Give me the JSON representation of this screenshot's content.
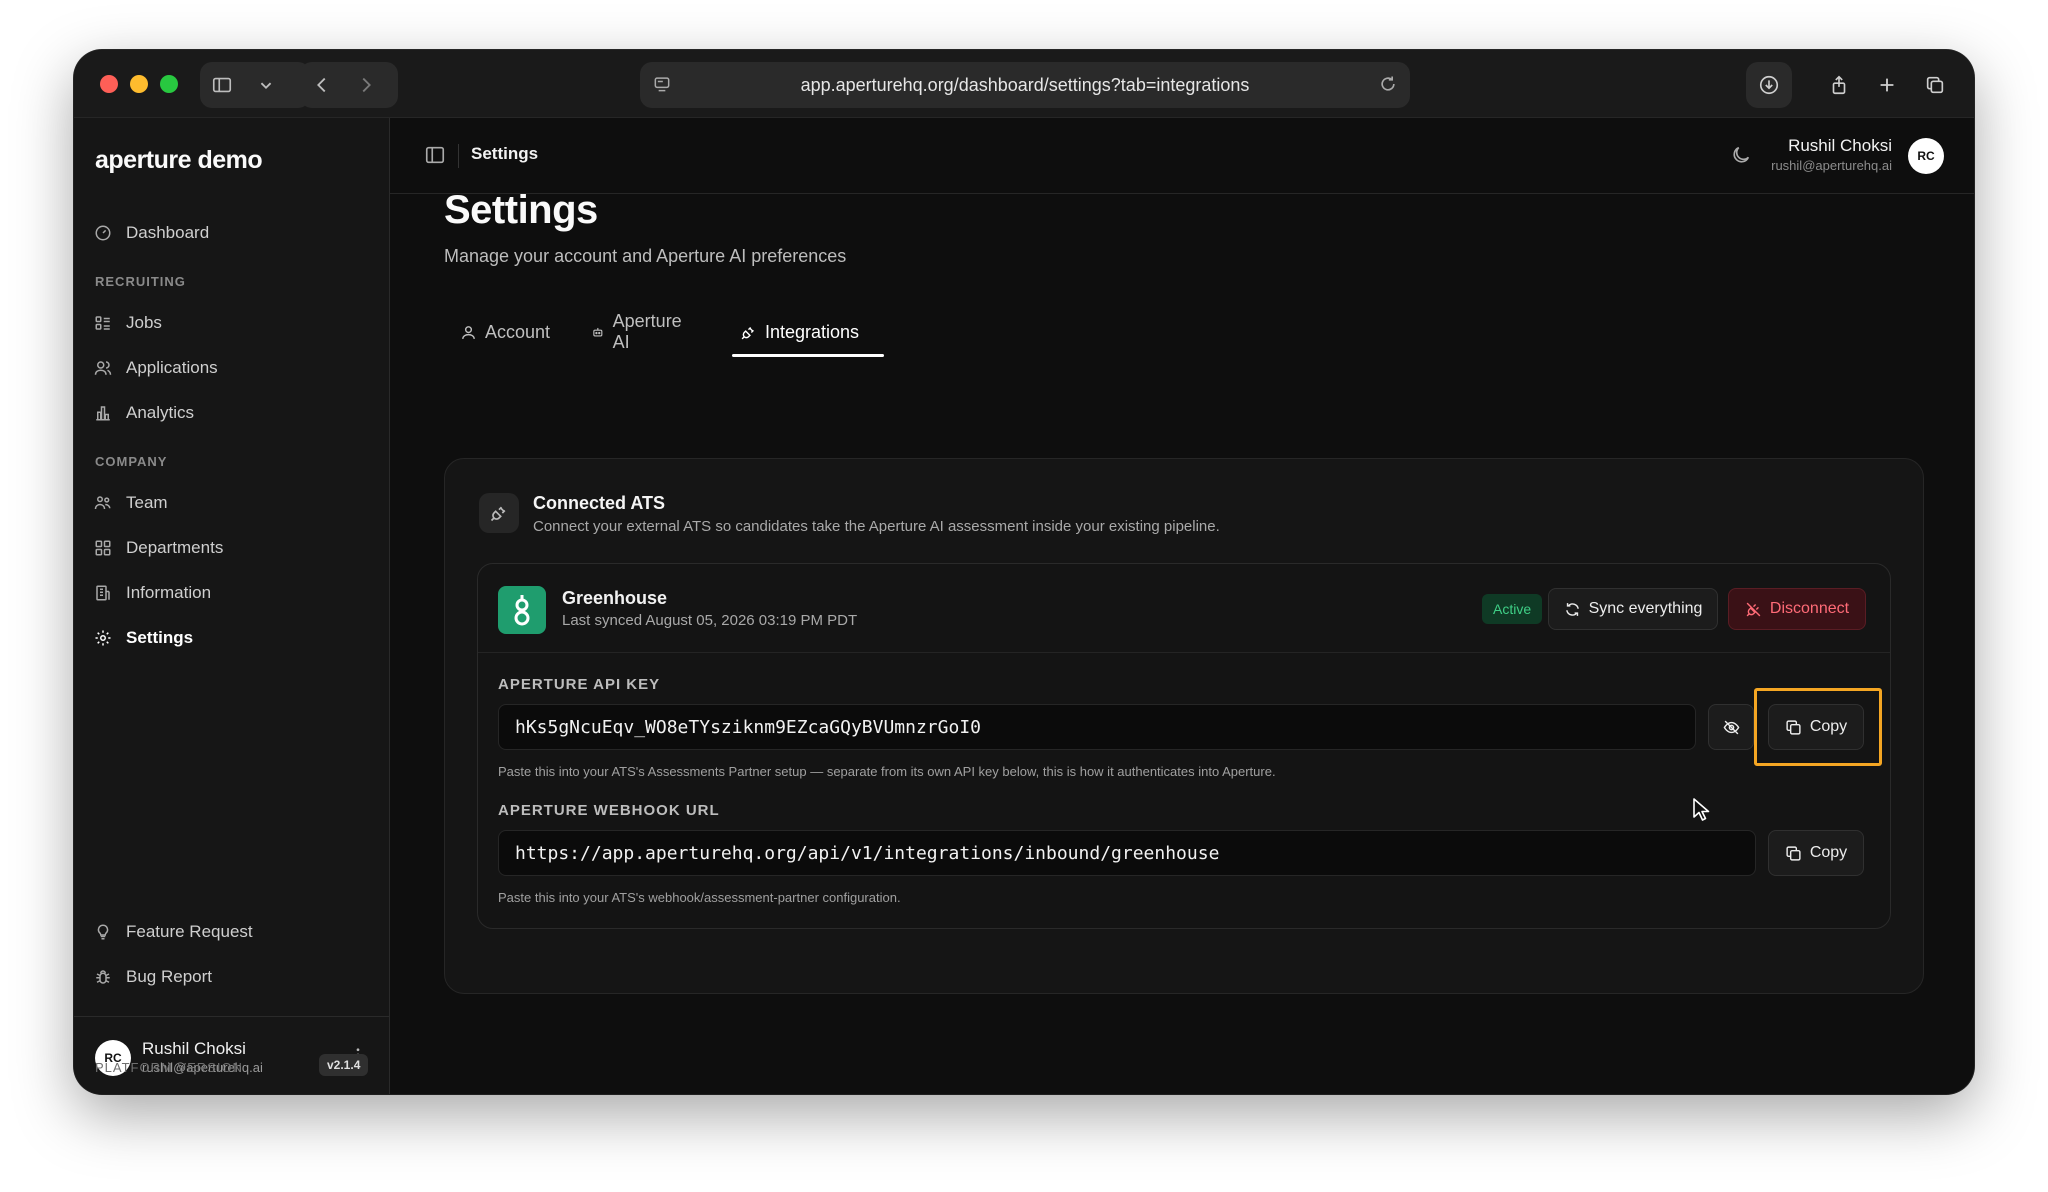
{
  "browser": {
    "url": "app.aperturehq.org/dashboard/settings?tab=integrations"
  },
  "sidebar": {
    "brand": "aperture demo",
    "items": [
      {
        "label": "Dashboard"
      },
      {
        "label": "Jobs"
      },
      {
        "label": "Applications"
      },
      {
        "label": "Analytics"
      },
      {
        "label": "Team"
      },
      {
        "label": "Departments"
      },
      {
        "label": "Information"
      },
      {
        "label": "Settings"
      }
    ],
    "sections": {
      "recruiting": "RECRUITING",
      "company": "COMPANY"
    },
    "footer_items": [
      {
        "label": "Feature Request"
      },
      {
        "label": "Bug Report"
      }
    ],
    "user": {
      "initials": "RC",
      "name": "Rushil Choksi",
      "email": "rushil@aperturehq.ai"
    },
    "platform_label": "PLATFORM VERSION",
    "version": "v2.1.4"
  },
  "header": {
    "breadcrumb": "Settings",
    "user_name": "Rushil Choksi",
    "user_email": "rushil@aperturehq.ai",
    "initials": "RC"
  },
  "main": {
    "title": "Settings",
    "subtitle": "Manage your account and Aperture AI preferences",
    "tabs": [
      {
        "label": "Account"
      },
      {
        "label": "Aperture AI"
      },
      {
        "label": "Integrations"
      }
    ],
    "active_tab": "Integrations",
    "card": {
      "title": "Connected ATS",
      "description": "Connect your external ATS so candidates take the Aperture AI assessment inside your existing pipeline.",
      "integration": {
        "name": "Greenhouse",
        "last_synced": "Last synced August 05, 2026 03:19 PM PDT",
        "status": "Active",
        "sync_label": "Sync everything",
        "disconnect_label": "Disconnect"
      },
      "api_key": {
        "label": "APERTURE API KEY",
        "value": "hKs5gNcuEqv_WO8eTYsziknm9EZcaGQyBVUmnzrGoI0",
        "help": "Paste this into your ATS's Assessments Partner setup — separate from its own API key below, this is how it authenticates into Aperture.",
        "copy_label": "Copy"
      },
      "webhook": {
        "label": "APERTURE WEBHOOK URL",
        "value": "https://app.aperturehq.org/api/v1/integrations/inbound/greenhouse",
        "help": "Paste this into your ATS's webhook/assessment-partner configuration.",
        "copy_label": "Copy"
      }
    }
  },
  "colors": {
    "accent_highlight": "#f5a623",
    "active_badge": "#3fcf86",
    "danger": "#ff6b77",
    "greenhouse": "#1f9d6e"
  }
}
